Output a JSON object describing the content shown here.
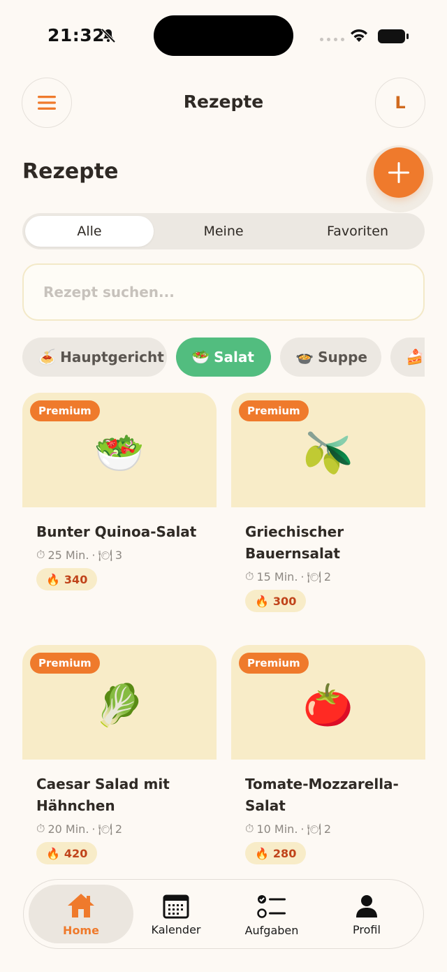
{
  "status": {
    "time": "21:32"
  },
  "header": {
    "title": "Rezepte",
    "avatar_letter": "L"
  },
  "page": {
    "title": "Rezepte"
  },
  "tabs": [
    {
      "label": "Alle",
      "active": true
    },
    {
      "label": "Meine",
      "active": false
    },
    {
      "label": "Favoriten",
      "active": false
    }
  ],
  "search": {
    "placeholder": "Rezept suchen..."
  },
  "categories": [
    {
      "emoji": "🍝",
      "label": "Hauptgericht",
      "active": false
    },
    {
      "emoji": "🥗",
      "label": "Salat",
      "active": true
    },
    {
      "emoji": "🍲",
      "label": "Suppe",
      "active": false
    },
    {
      "emoji": "🍰",
      "label": "",
      "active": false
    }
  ],
  "recipes": [
    {
      "badge": "Premium",
      "emoji": "🥗",
      "title": "Bunter Quinoa-Salat",
      "time": "25 Min.",
      "servings": "3",
      "calories": "340"
    },
    {
      "badge": "Premium",
      "emoji": "🫒",
      "title": "Griechischer Bauernsalat",
      "time": "15 Min.",
      "servings": "2",
      "calories": "300"
    },
    {
      "badge": "Premium",
      "emoji": "🥬",
      "title": "Caesar Salad mit Hähnchen",
      "time": "20 Min.",
      "servings": "2",
      "calories": "420"
    },
    {
      "badge": "Premium",
      "emoji": "🍅",
      "title": "Tomate-Mozzarella-Salat",
      "time": "10 Min.",
      "servings": "2",
      "calories": "280"
    }
  ],
  "icons": {
    "time": "⏱",
    "servings": "🍽",
    "calories": "🔥"
  },
  "meta_separator": "·",
  "nav": [
    {
      "label": "Home",
      "icon": "home-icon",
      "active": true
    },
    {
      "label": "Kalender",
      "icon": "calendar-icon",
      "active": false
    },
    {
      "label": "Aufgaben",
      "icon": "tasks-icon",
      "active": false
    },
    {
      "label": "Profil",
      "icon": "profile-icon",
      "active": false
    }
  ],
  "colors": {
    "accent": "#ef7a2c",
    "chip_active": "#52bd7f",
    "card_bg": "#f8ecc8",
    "background": "#fdf9f4"
  }
}
